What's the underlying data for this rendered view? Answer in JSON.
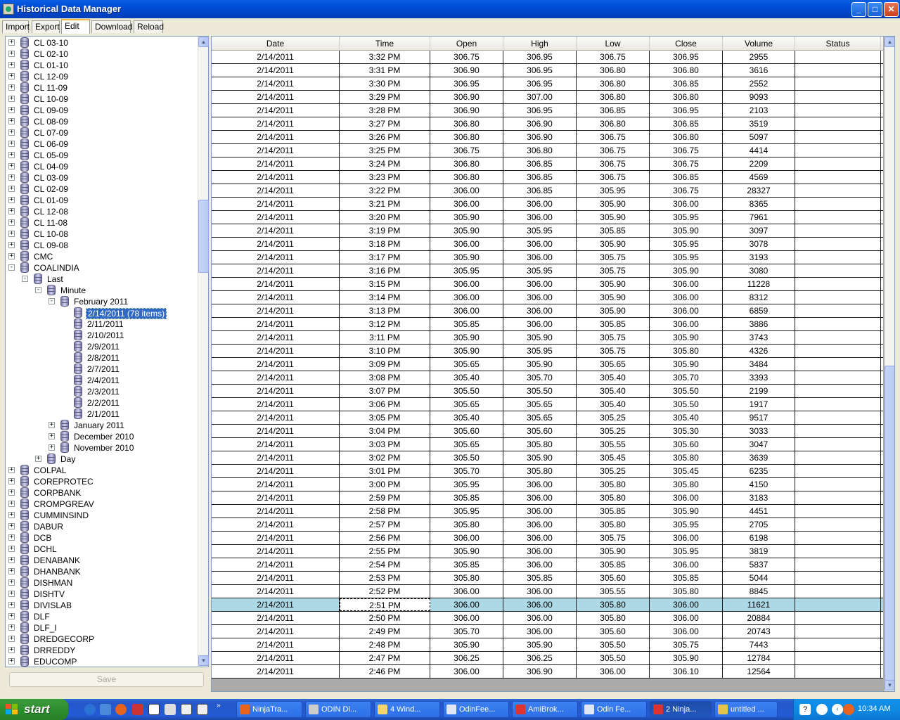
{
  "window": {
    "title": "Historical Data Manager"
  },
  "menu_tabs": [
    "Import",
    "Export",
    "Edit",
    "Download",
    "Reload"
  ],
  "tree": [
    {
      "label": "CL 03-10",
      "level": 0,
      "expander": "+"
    },
    {
      "label": "CL 02-10",
      "level": 0,
      "expander": "+"
    },
    {
      "label": "CL 01-10",
      "level": 0,
      "expander": "+"
    },
    {
      "label": "CL 12-09",
      "level": 0,
      "expander": "+"
    },
    {
      "label": "CL 11-09",
      "level": 0,
      "expander": "+"
    },
    {
      "label": "CL 10-09",
      "level": 0,
      "expander": "+"
    },
    {
      "label": "CL 09-09",
      "level": 0,
      "expander": "+"
    },
    {
      "label": "CL 08-09",
      "level": 0,
      "expander": "+"
    },
    {
      "label": "CL 07-09",
      "level": 0,
      "expander": "+"
    },
    {
      "label": "CL 06-09",
      "level": 0,
      "expander": "+"
    },
    {
      "label": "CL 05-09",
      "level": 0,
      "expander": "+"
    },
    {
      "label": "CL 04-09",
      "level": 0,
      "expander": "+"
    },
    {
      "label": "CL 03-09",
      "level": 0,
      "expander": "+"
    },
    {
      "label": "CL 02-09",
      "level": 0,
      "expander": "+"
    },
    {
      "label": "CL 01-09",
      "level": 0,
      "expander": "+"
    },
    {
      "label": "CL 12-08",
      "level": 0,
      "expander": "+"
    },
    {
      "label": "CL 11-08",
      "level": 0,
      "expander": "+"
    },
    {
      "label": "CL 10-08",
      "level": 0,
      "expander": "+"
    },
    {
      "label": "CL 09-08",
      "level": 0,
      "expander": "+"
    },
    {
      "label": "CMC",
      "level": 0,
      "expander": "+"
    },
    {
      "label": "COALINDIA",
      "level": 0,
      "expander": "-"
    },
    {
      "label": "Last",
      "level": 1,
      "expander": "-"
    },
    {
      "label": "Minute",
      "level": 2,
      "expander": "-"
    },
    {
      "label": "February 2011",
      "level": 3,
      "expander": "-"
    },
    {
      "label": "2/14/2011 (78 items)",
      "level": 4,
      "expander": "",
      "selected": true
    },
    {
      "label": "2/11/2011",
      "level": 4,
      "expander": ""
    },
    {
      "label": "2/10/2011",
      "level": 4,
      "expander": ""
    },
    {
      "label": "2/9/2011",
      "level": 4,
      "expander": ""
    },
    {
      "label": "2/8/2011",
      "level": 4,
      "expander": ""
    },
    {
      "label": "2/7/2011",
      "level": 4,
      "expander": ""
    },
    {
      "label": "2/4/2011",
      "level": 4,
      "expander": ""
    },
    {
      "label": "2/3/2011",
      "level": 4,
      "expander": ""
    },
    {
      "label": "2/2/2011",
      "level": 4,
      "expander": ""
    },
    {
      "label": "2/1/2011",
      "level": 4,
      "expander": ""
    },
    {
      "label": "January 2011",
      "level": 3,
      "expander": "+"
    },
    {
      "label": "December 2010",
      "level": 3,
      "expander": "+"
    },
    {
      "label": "November 2010",
      "level": 3,
      "expander": "+"
    },
    {
      "label": "Day",
      "level": 2,
      "expander": "+"
    },
    {
      "label": "COLPAL",
      "level": 0,
      "expander": "+"
    },
    {
      "label": "COREPROTEC",
      "level": 0,
      "expander": "+"
    },
    {
      "label": "CORPBANK",
      "level": 0,
      "expander": "+"
    },
    {
      "label": "CROMPGREAV",
      "level": 0,
      "expander": "+"
    },
    {
      "label": "CUMMINSIND",
      "level": 0,
      "expander": "+"
    },
    {
      "label": "DABUR",
      "level": 0,
      "expander": "+"
    },
    {
      "label": "DCB",
      "level": 0,
      "expander": "+"
    },
    {
      "label": "DCHL",
      "level": 0,
      "expander": "+"
    },
    {
      "label": "DENABANK",
      "level": 0,
      "expander": "+"
    },
    {
      "label": "DHANBANK",
      "level": 0,
      "expander": "+"
    },
    {
      "label": "DISHMAN",
      "level": 0,
      "expander": "+"
    },
    {
      "label": "DISHTV",
      "level": 0,
      "expander": "+"
    },
    {
      "label": "DIVISLAB",
      "level": 0,
      "expander": "+"
    },
    {
      "label": "DLF",
      "level": 0,
      "expander": "+"
    },
    {
      "label": "DLF_I",
      "level": 0,
      "expander": "+"
    },
    {
      "label": "DREDGECORP",
      "level": 0,
      "expander": "+"
    },
    {
      "label": "DRREDDY",
      "level": 0,
      "expander": "+"
    },
    {
      "label": "EDUCOMP",
      "level": 0,
      "expander": "+"
    }
  ],
  "save_label": "Save",
  "grid": {
    "columns": [
      "Date",
      "Time",
      "Open",
      "High",
      "Low",
      "Close",
      "Volume",
      "Status"
    ],
    "selected_row": 41,
    "rows": [
      [
        "2/14/2011",
        "3:32 PM",
        "306.75",
        "306.95",
        "306.75",
        "306.95",
        "2955",
        ""
      ],
      [
        "2/14/2011",
        "3:31 PM",
        "306.90",
        "306.95",
        "306.80",
        "306.80",
        "3616",
        ""
      ],
      [
        "2/14/2011",
        "3:30 PM",
        "306.95",
        "306.95",
        "306.80",
        "306.85",
        "2552",
        ""
      ],
      [
        "2/14/2011",
        "3:29 PM",
        "306.90",
        "307.00",
        "306.80",
        "306.80",
        "9093",
        ""
      ],
      [
        "2/14/2011",
        "3:28 PM",
        "306.90",
        "306.95",
        "306.85",
        "306.95",
        "2103",
        ""
      ],
      [
        "2/14/2011",
        "3:27 PM",
        "306.80",
        "306.90",
        "306.80",
        "306.85",
        "3519",
        ""
      ],
      [
        "2/14/2011",
        "3:26 PM",
        "306.80",
        "306.90",
        "306.75",
        "306.80",
        "5097",
        ""
      ],
      [
        "2/14/2011",
        "3:25 PM",
        "306.75",
        "306.80",
        "306.75",
        "306.75",
        "4414",
        ""
      ],
      [
        "2/14/2011",
        "3:24 PM",
        "306.80",
        "306.85",
        "306.75",
        "306.75",
        "2209",
        ""
      ],
      [
        "2/14/2011",
        "3:23 PM",
        "306.80",
        "306.85",
        "306.75",
        "306.85",
        "4569",
        ""
      ],
      [
        "2/14/2011",
        "3:22 PM",
        "306.00",
        "306.85",
        "305.95",
        "306.75",
        "28327",
        ""
      ],
      [
        "2/14/2011",
        "3:21 PM",
        "306.00",
        "306.00",
        "305.90",
        "306.00",
        "8365",
        ""
      ],
      [
        "2/14/2011",
        "3:20 PM",
        "305.90",
        "306.00",
        "305.90",
        "305.95",
        "7961",
        ""
      ],
      [
        "2/14/2011",
        "3:19 PM",
        "305.90",
        "305.95",
        "305.85",
        "305.90",
        "3097",
        ""
      ],
      [
        "2/14/2011",
        "3:18 PM",
        "306.00",
        "306.00",
        "305.90",
        "305.95",
        "3078",
        ""
      ],
      [
        "2/14/2011",
        "3:17 PM",
        "305.90",
        "306.00",
        "305.75",
        "305.95",
        "3193",
        ""
      ],
      [
        "2/14/2011",
        "3:16 PM",
        "305.95",
        "305.95",
        "305.75",
        "305.90",
        "3080",
        ""
      ],
      [
        "2/14/2011",
        "3:15 PM",
        "306.00",
        "306.00",
        "305.90",
        "306.00",
        "11228",
        ""
      ],
      [
        "2/14/2011",
        "3:14 PM",
        "306.00",
        "306.00",
        "305.90",
        "306.00",
        "8312",
        ""
      ],
      [
        "2/14/2011",
        "3:13 PM",
        "306.00",
        "306.00",
        "305.90",
        "306.00",
        "6859",
        ""
      ],
      [
        "2/14/2011",
        "3:12 PM",
        "305.85",
        "306.00",
        "305.85",
        "306.00",
        "3886",
        ""
      ],
      [
        "2/14/2011",
        "3:11 PM",
        "305.90",
        "305.90",
        "305.75",
        "305.90",
        "3743",
        ""
      ],
      [
        "2/14/2011",
        "3:10 PM",
        "305.90",
        "305.95",
        "305.75",
        "305.80",
        "4326",
        ""
      ],
      [
        "2/14/2011",
        "3:09 PM",
        "305.65",
        "305.90",
        "305.65",
        "305.90",
        "3484",
        ""
      ],
      [
        "2/14/2011",
        "3:08 PM",
        "305.40",
        "305.70",
        "305.40",
        "305.70",
        "3393",
        ""
      ],
      [
        "2/14/2011",
        "3:07 PM",
        "305.50",
        "305.50",
        "305.40",
        "305.50",
        "2199",
        ""
      ],
      [
        "2/14/2011",
        "3:06 PM",
        "305.65",
        "305.65",
        "305.40",
        "305.50",
        "1917",
        ""
      ],
      [
        "2/14/2011",
        "3:05 PM",
        "305.40",
        "305.65",
        "305.25",
        "305.40",
        "9517",
        ""
      ],
      [
        "2/14/2011",
        "3:04 PM",
        "305.60",
        "305.60",
        "305.25",
        "305.30",
        "3033",
        ""
      ],
      [
        "2/14/2011",
        "3:03 PM",
        "305.65",
        "305.80",
        "305.55",
        "305.60",
        "3047",
        ""
      ],
      [
        "2/14/2011",
        "3:02 PM",
        "305.50",
        "305.90",
        "305.45",
        "305.80",
        "3639",
        ""
      ],
      [
        "2/14/2011",
        "3:01 PM",
        "305.70",
        "305.80",
        "305.25",
        "305.45",
        "6235",
        ""
      ],
      [
        "2/14/2011",
        "3:00 PM",
        "305.95",
        "306.00",
        "305.80",
        "305.80",
        "4150",
        ""
      ],
      [
        "2/14/2011",
        "2:59 PM",
        "305.85",
        "306.00",
        "305.80",
        "306.00",
        "3183",
        ""
      ],
      [
        "2/14/2011",
        "2:58 PM",
        "305.95",
        "306.00",
        "305.85",
        "305.90",
        "4451",
        ""
      ],
      [
        "2/14/2011",
        "2:57 PM",
        "305.80",
        "306.00",
        "305.80",
        "305.95",
        "2705",
        ""
      ],
      [
        "2/14/2011",
        "2:56 PM",
        "306.00",
        "306.00",
        "305.75",
        "306.00",
        "6198",
        ""
      ],
      [
        "2/14/2011",
        "2:55 PM",
        "305.90",
        "306.00",
        "305.90",
        "305.95",
        "3819",
        ""
      ],
      [
        "2/14/2011",
        "2:54 PM",
        "305.85",
        "306.00",
        "305.85",
        "306.00",
        "5837",
        ""
      ],
      [
        "2/14/2011",
        "2:53 PM",
        "305.80",
        "305.85",
        "305.60",
        "305.85",
        "5044",
        ""
      ],
      [
        "2/14/2011",
        "2:52 PM",
        "306.00",
        "306.00",
        "305.55",
        "305.80",
        "8845",
        ""
      ],
      [
        "2/14/2011",
        "2:51 PM",
        "306.00",
        "306.00",
        "305.80",
        "306.00",
        "11621",
        ""
      ],
      [
        "2/14/2011",
        "2:50 PM",
        "306.00",
        "306.00",
        "305.80",
        "306.00",
        "20884",
        ""
      ],
      [
        "2/14/2011",
        "2:49 PM",
        "305.70",
        "306.00",
        "305.60",
        "306.00",
        "20743",
        ""
      ],
      [
        "2/14/2011",
        "2:48 PM",
        "305.90",
        "305.90",
        "305.50",
        "305.75",
        "7443",
        ""
      ],
      [
        "2/14/2011",
        "2:47 PM",
        "306.25",
        "306.25",
        "305.50",
        "305.90",
        "12784",
        ""
      ],
      [
        "2/14/2011",
        "2:46 PM",
        "306.00",
        "306.90",
        "306.00",
        "306.10",
        "12564",
        ""
      ]
    ]
  },
  "taskbar": {
    "start_label": "start",
    "tasks": [
      {
        "label": "NinjaTra...",
        "icon_color": "#e8641e"
      },
      {
        "label": "ODIN Di...",
        "icon_color": "#cccccc"
      },
      {
        "label": "4 Wind...",
        "icon_color": "#f3d36b"
      },
      {
        "label": "OdinFee...",
        "icon_color": "#e0e8f8"
      },
      {
        "label": "AmiBrok...",
        "icon_color": "#d33"
      },
      {
        "label": "Odin Fe...",
        "icon_color": "#e0e8f8"
      },
      {
        "label": "2 Ninja...",
        "icon_color": "#d33",
        "active": true
      },
      {
        "label": "untitled ...",
        "icon_color": "#e6c34a"
      }
    ],
    "clock": "10:34 AM"
  }
}
